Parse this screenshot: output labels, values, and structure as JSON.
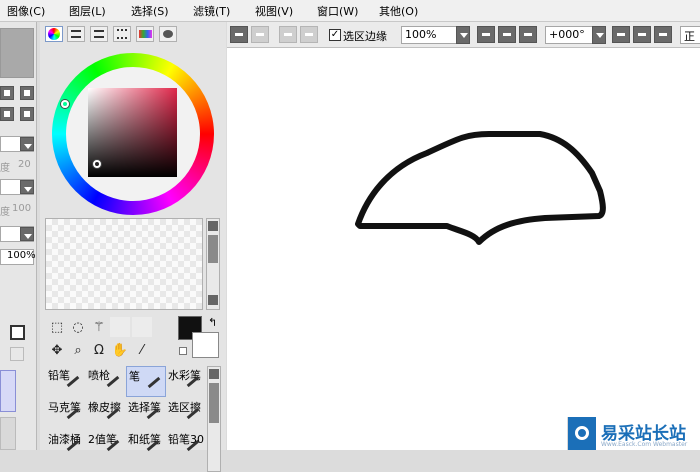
{
  "menu": {
    "items": [
      "图像(C)",
      "图层(L)",
      "选择(S)",
      "滤镜(T)",
      "视图(V)",
      "窗口(W)",
      "其他(O)"
    ]
  },
  "left_panel": {
    "density_label": "度",
    "density_value": "20",
    "strength_label": "度",
    "strength_value": "100",
    "percent_value": "100%"
  },
  "canvas_toolbar": {
    "selection_edge_label": "选区边缘",
    "selection_edge_checked": true,
    "zoom": "100%",
    "rotation": "+000°",
    "right_label": "正"
  },
  "tools": {
    "brushes": [
      "铅笔",
      "喷枪",
      "笔",
      "水彩笔",
      "马克笔",
      "橡皮擦",
      "选择笔",
      "选区擦",
      "油漆桶",
      "2值笔",
      "和纸笔",
      "铅笔30"
    ],
    "selected_brush": "笔"
  },
  "colors": {
    "foreground": "#111111",
    "background": "#ffffff",
    "accent_selected": "#cfd9f5",
    "stroke": "#111111"
  },
  "icons": [
    "undo-icon",
    "redo-icon",
    "deselect-icon",
    "invert-selection-icon",
    "zoom-out-icon",
    "zoom-in-icon",
    "reset-zoom-icon",
    "rotate-ccw-icon",
    "rotate-cw-icon",
    "reset-rotation-icon"
  ],
  "watermark": {
    "text": "易采站长站",
    "subtext": "Www.Easck.Com Webmaster"
  }
}
